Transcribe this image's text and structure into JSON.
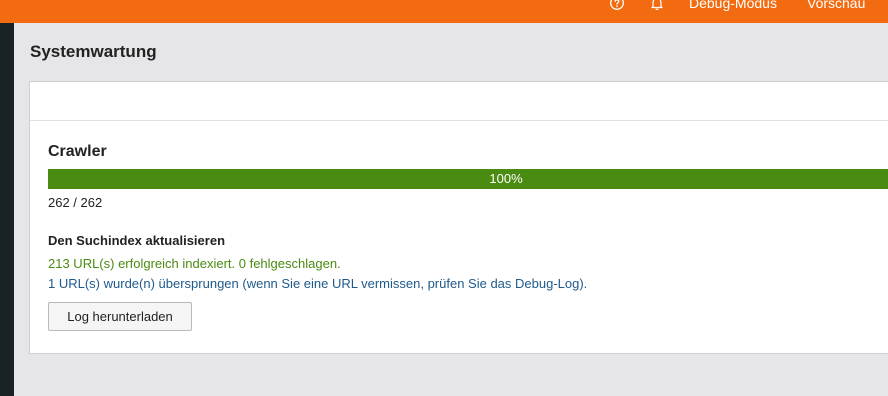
{
  "topbar": {
    "background": "#f26b10",
    "help_icon": "help-circle-icon",
    "notification_icon": "bell-icon",
    "debug_mode_label": "Debug-Modus",
    "preview_label": "Vorschau"
  },
  "page": {
    "title": "Systemwartung"
  },
  "crawler": {
    "title": "Crawler",
    "progress_fraction": 1.0,
    "progress_label": "100%",
    "progress_count": "262 / 262",
    "progress_color": "#4a8b12"
  },
  "search_index": {
    "heading": "Den Suchindex aktualisieren",
    "success_message": "213 URL(s) erfolgreich indexiert. 0 fehlgeschlagen.",
    "success_color": "#4a8b12",
    "skipped_message": "1 URL(s) wurde(n) übersprungen (wenn Sie eine URL vermissen, prüfen Sie das Debug-Log).",
    "skipped_color": "#1f5a8c",
    "download_log_label": "Log herunterladen"
  }
}
